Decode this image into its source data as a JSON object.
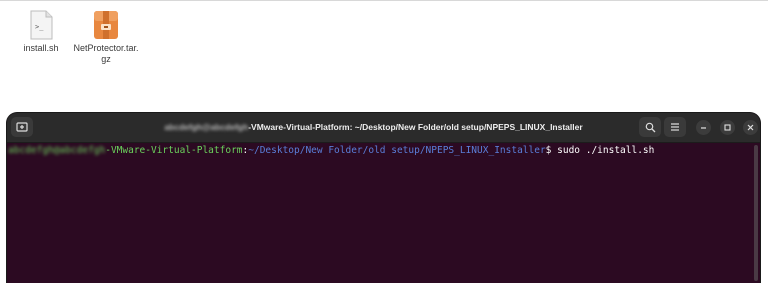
{
  "desktop": {
    "files": [
      {
        "name": "install.sh",
        "icon": "shell-script-icon"
      },
      {
        "name": "NetProtector.tar.gz",
        "icon": "archive-icon"
      }
    ]
  },
  "terminal": {
    "title_blurred": "abcdefgh@abcdefgh",
    "title_host_suffix": "-VMware-Virtual-Platform: ~/Desktop/New Folder/old setup/NPEPS_LINUX_Installer",
    "prompt_user_blurred": "abcdefgh@abcdefgh",
    "prompt_host_suffix": "-VMware-Virtual-Platform",
    "prompt_separator": ":",
    "prompt_path": "~/Desktop/New Folder/old setup/NPEPS_LINUX_Installer",
    "prompt_symbol": "$",
    "command": " sudo ./install.sh",
    "colors": {
      "background": "#2c0a22",
      "titlebar": "#2b2b2b",
      "user": "#6bd15c",
      "path": "#5a7ed8"
    }
  }
}
